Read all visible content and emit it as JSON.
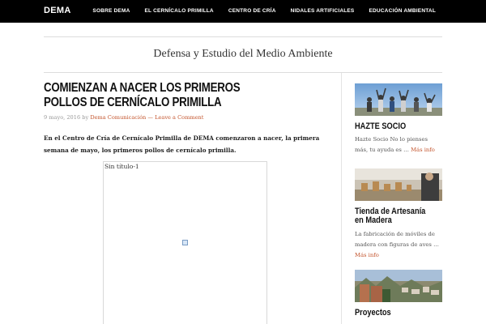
{
  "header": {
    "logo": "DEMA",
    "nav": [
      {
        "label": "SOBRE DEMA"
      },
      {
        "label": "EL CERNÍCALO PRIMILLA"
      },
      {
        "label": "CENTRO DE CRÍA"
      },
      {
        "label": "NIDALES ARTIFICIALES"
      },
      {
        "label": "EDUCACIÓN AMBIENTAL"
      }
    ]
  },
  "site": {
    "tagline": "Defensa y Estudio del Medio Ambiente"
  },
  "post": {
    "title": "COMIENZAN A NACER LOS PRIMEROS POLLOS DE CERNÍCALO PRIMILLA",
    "date": "9 mayo, 2016",
    "by": "by",
    "author": "Dema Comunicación",
    "separator": "—",
    "comment_link": "Leave a Comment",
    "intro": "En el Centro de Cría de Cernícalo Primilla de DEMA comenzaron a nacer, la primera semana de mayo, los primeros pollos de cernícalo primilla.",
    "figure_caption": "Sin título-1"
  },
  "sidebar": {
    "widgets": [
      {
        "title": "HAZTE SOCIO",
        "text": "Hazte Socio No lo pienses más, tu ayuda es …",
        "more": "Más info"
      },
      {
        "title": "Tienda de Artesanía en Madera",
        "text": "La fabricación de móviles de madera con figuras de aves …",
        "more": "Más info"
      },
      {
        "title": "Proyectos",
        "text": "",
        "more": ""
      }
    ]
  }
}
